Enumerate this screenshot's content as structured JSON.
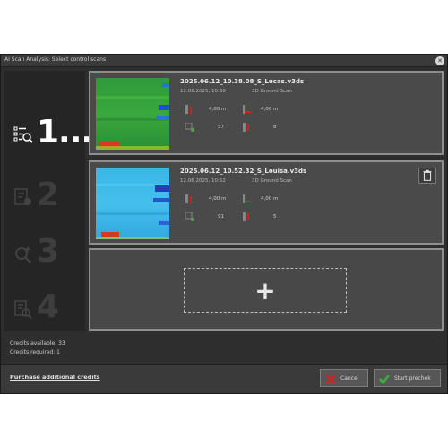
{
  "window": {
    "title": "AI Scan Analysis: Select control scans",
    "close_icon": "close-icon"
  },
  "steps": [
    {
      "number": "1...",
      "icon": "list-search-icon",
      "active": true
    },
    {
      "number": "2",
      "icon": "document-settings-icon",
      "active": false
    },
    {
      "number": "3",
      "icon": "magic-search-icon",
      "active": false
    },
    {
      "number": "4",
      "icon": "document-search-icon",
      "active": false
    }
  ],
  "scans": [
    {
      "name": "2025.06.12_10.38.08_S_Lucas.v3ds",
      "date": "12.06.2025, 10:38",
      "type": "3D Ground Scan",
      "depth": "4,00 m",
      "length": "4,00 m",
      "impulses": "57",
      "lines": "8"
    },
    {
      "name": "2025.06.12_10.52.32_S_Louisa.v3ds",
      "date": "12.06.2025, 10:52",
      "type": "3D Ground Scan",
      "depth": "4,00 m",
      "length": "4,00 m",
      "impulses": "91",
      "lines": "5"
    }
  ],
  "add_card": {
    "icon": "plus-icon",
    "label": "+"
  },
  "credits": {
    "available": "Credits available: 33",
    "required": "Credits required: 1"
  },
  "footer": {
    "purchase_label": "Purchase additional credits",
    "cancel_label": "Cancel",
    "start_label": "Start prechek"
  },
  "colors": {
    "background": "#2e2e2e",
    "card": "#4a4a4a",
    "accent_red": "#d02020",
    "accent_green": "#3fae3f"
  }
}
